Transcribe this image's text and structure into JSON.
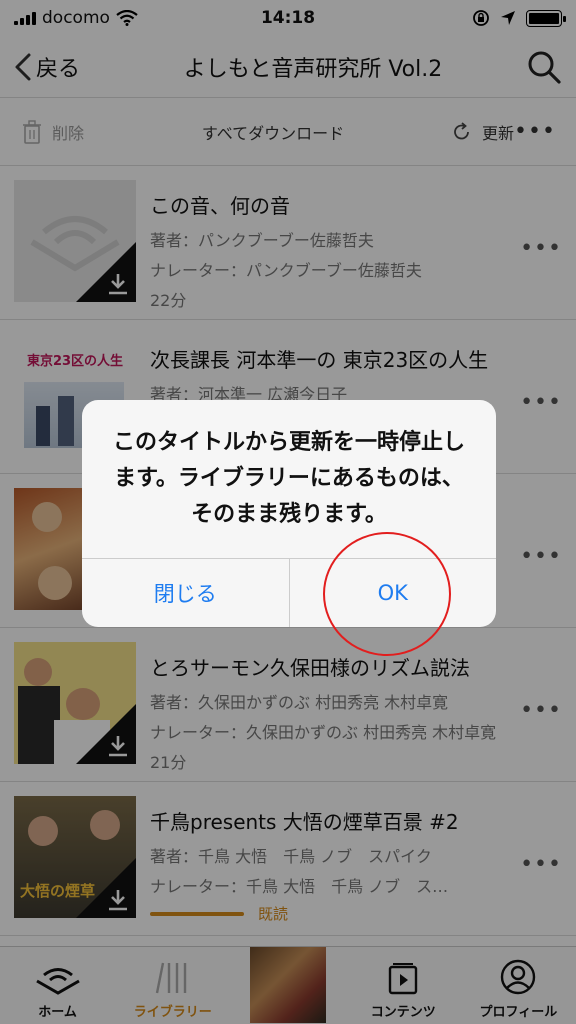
{
  "status_bar": {
    "carrier": "docomo",
    "time": "14:18"
  },
  "nav": {
    "back_label": "戻る",
    "title": "よしもと音声研究所 Vol.2"
  },
  "toolbar": {
    "delete_label": "削除",
    "download_all_label": "すべてダウンロード",
    "refresh_label": "更新",
    "more": "•••"
  },
  "items": [
    {
      "title": "この音、何の音",
      "author": "著者：パンクブーブー佐藤哲夫",
      "narrator": "ナレーター：パンクブーブー佐藤哲夫",
      "duration": "22分"
    },
    {
      "title": "次長課長 河本準一の 東京23区の人生",
      "author": "著者：河本準一 広瀬今日子",
      "thumb_text": "東京23区の人生"
    },
    {
      "title": "",
      "author": ""
    },
    {
      "title": "とろサーモン久保田様のリズム説法",
      "author": "著者：久保田かずのぶ 村田秀亮 木村卓寛",
      "narrator": "ナレーター：久保田かずのぶ 村田秀亮 木村卓寛",
      "duration": "21分"
    },
    {
      "title": "千鳥presents 大悟の煙草百景 #2",
      "author": "著者：千鳥 大悟　千鳥 ノブ　スパイク",
      "narrator": "ナレーター：千鳥 大悟　千鳥 ノブ　ス…",
      "status": "既読",
      "thumb_text": "大悟の煙草"
    }
  ],
  "dialog": {
    "message": "このタイトルから更新を一時停止します。ライブラリーにあるものは、そのまま残ります。",
    "close_label": "閉じる",
    "ok_label": "OK"
  },
  "tabs": {
    "home": "ホーム",
    "library": "ライブラリー",
    "content": "コンテンツ",
    "profile": "プロフィール"
  },
  "colors": {
    "accent": "#d68a1a",
    "dialog_button": "#1e7cf0",
    "annotation": "#e21e1e"
  }
}
